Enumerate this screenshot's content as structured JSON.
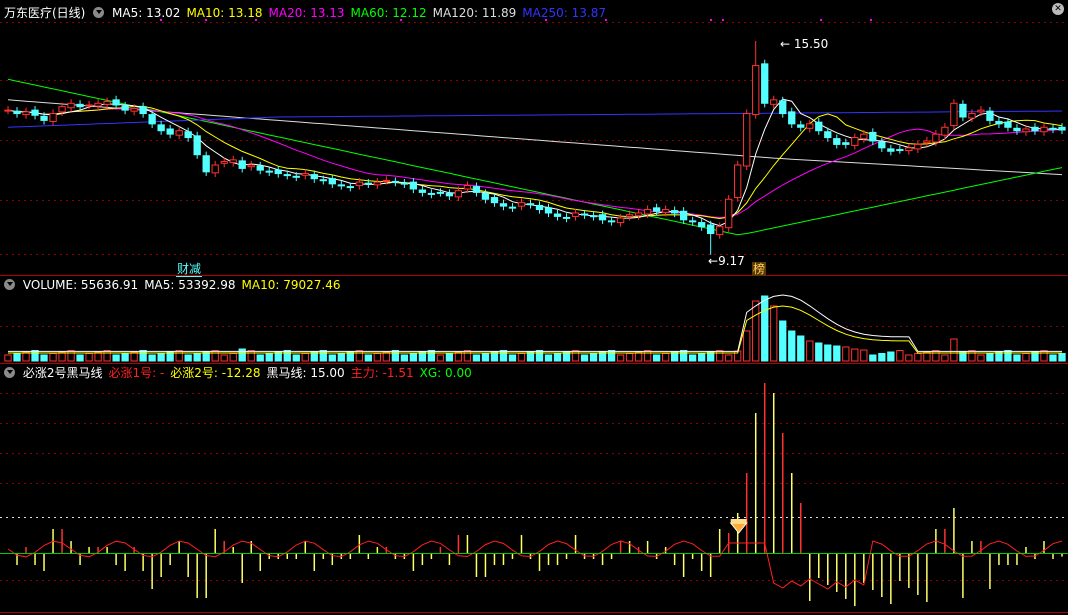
{
  "stock_title": "万东医疗(日线)",
  "ma_legend": [
    {
      "label": "MA5: 13.02",
      "color": "#ffffff"
    },
    {
      "label": "MA10: 13.18",
      "color": "#ffff00"
    },
    {
      "label": "MA20: 13.13",
      "color": "#ff00ff"
    },
    {
      "label": "MA60: 12.12",
      "color": "#00ff00"
    },
    {
      "label": "MA120: 11.89",
      "color": "#dddddd"
    },
    {
      "label": "MA250: 13.87",
      "color": "#3333ff"
    }
  ],
  "annotations": {
    "high_label": "15.50",
    "low_label": "9.17",
    "tag_left": "财减",
    "tag_right": "榜"
  },
  "volume_legend": [
    {
      "label": "VOLUME: 55636.91",
      "color": "#ffffff"
    },
    {
      "label": "MA5: 53392.98",
      "color": "#ffffff"
    },
    {
      "label": "MA10: 79027.46",
      "color": "#ffff00"
    }
  ],
  "indicator_legend": [
    {
      "label": "必涨2号黑马线",
      "color": "#ffffff"
    },
    {
      "label": "必涨1号: -",
      "color": "#ff2020"
    },
    {
      "label": "必涨2号: -12.28",
      "color": "#ffff00"
    },
    {
      "label": "黑马线: 15.00",
      "color": "#ffffff"
    },
    {
      "label": "主力: -1.51",
      "color": "#ff2020"
    },
    {
      "label": "XG: 0.00",
      "color": "#00ff00"
    }
  ],
  "colors": {
    "up": "#ff3232",
    "down": "#54ffff",
    "background": "#000000",
    "grid": "#8b0000"
  },
  "chart_data": {
    "type": "candlestick",
    "price_scale": [
      9.17,
      15.5
    ],
    "notable": {
      "max_price": 15.5,
      "min_price": 9.17
    },
    "closes": [
      13.6,
      13.5,
      13.55,
      13.45,
      13.3,
      13.5,
      13.7,
      13.8,
      13.7,
      13.75,
      13.8,
      13.85,
      13.75,
      13.6,
      13.65,
      13.5,
      13.2,
      13.0,
      12.9,
      13.0,
      12.8,
      12.3,
      11.8,
      12.0,
      12.1,
      12.15,
      11.9,
      12.0,
      11.85,
      11.8,
      11.75,
      11.7,
      11.65,
      11.75,
      11.6,
      11.55,
      11.45,
      11.4,
      11.35,
      11.5,
      11.45,
      11.5,
      11.55,
      11.5,
      11.45,
      11.3,
      11.2,
      11.15,
      11.2,
      11.1,
      11.25,
      11.4,
      11.2,
      11.0,
      10.9,
      10.8,
      10.75,
      10.9,
      10.85,
      10.7,
      10.6,
      10.5,
      10.45,
      10.6,
      10.55,
      10.5,
      10.4,
      10.35,
      10.45,
      10.55,
      10.6,
      10.7,
      10.65,
      10.7,
      10.6,
      10.4,
      10.35,
      10.2,
      10.0,
      10.2,
      11.0,
      12.0,
      13.5,
      14.9,
      13.8,
      13.9,
      13.5,
      13.2,
      13.1,
      13.2,
      13.0,
      12.8,
      12.6,
      12.6,
      12.8,
      12.9,
      12.7,
      12.5,
      12.4,
      12.45,
      12.5,
      12.6,
      12.7,
      12.9,
      13.1,
      13.8,
      13.4,
      13.5,
      13.6,
      13.3,
      13.2,
      13.1,
      13.0,
      13.05,
      13.0,
      13.1,
      13.05,
      13.02
    ]
  }
}
